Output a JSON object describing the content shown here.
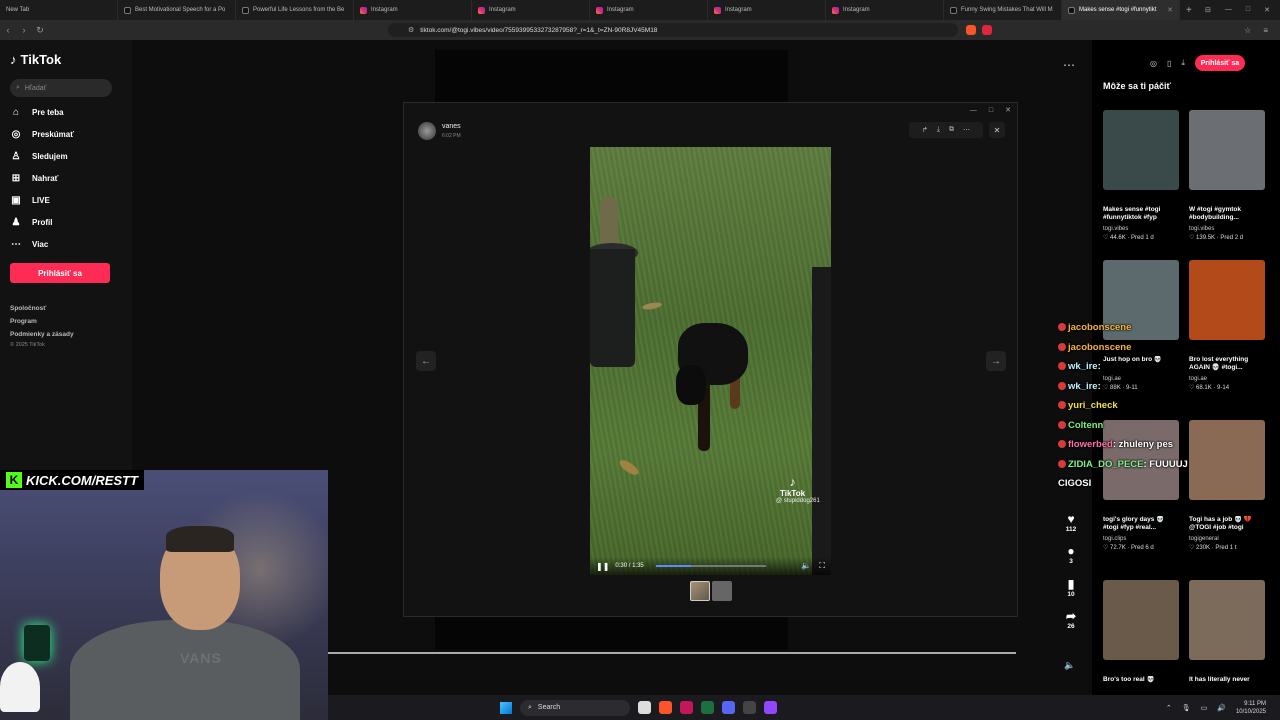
{
  "browser": {
    "tabs": [
      {
        "title": "New Tab",
        "icon": "none"
      },
      {
        "title": "Best Motivational Speech for a Po",
        "icon": "tiktok"
      },
      {
        "title": "Powerful Life Lessons from the Be",
        "icon": "tiktok"
      },
      {
        "title": "Instagram",
        "icon": "instagram"
      },
      {
        "title": "Instagram",
        "icon": "instagram"
      },
      {
        "title": "Instagram",
        "icon": "instagram"
      },
      {
        "title": "Instagram",
        "icon": "instagram"
      },
      {
        "title": "Instagram",
        "icon": "instagram"
      },
      {
        "title": "Funny Swing Mistakes That Will M",
        "icon": "tiktok"
      },
      {
        "title": "Makes sense #togi #funnytikt",
        "icon": "tiktok",
        "active": true
      }
    ],
    "url": "tiktok.com/@togi.vibes/video/7559399533273287958?_r=1&_t=ZN-90R8JV45M18"
  },
  "tiktok": {
    "logo": "TikTok",
    "search_placeholder": "Hľadať",
    "nav": [
      {
        "label": "Pre teba",
        "icon": "home-icon",
        "glyph": "⌂"
      },
      {
        "label": "Preskúmať",
        "icon": "compass-icon",
        "glyph": "◎"
      },
      {
        "label": "Sledujem",
        "icon": "following-icon",
        "glyph": "♙"
      },
      {
        "label": "Nahrať",
        "icon": "upload-icon",
        "glyph": "⊞"
      },
      {
        "label": "LIVE",
        "icon": "live-icon",
        "glyph": "▣"
      },
      {
        "label": "Profil",
        "icon": "profile-icon",
        "glyph": "♟"
      },
      {
        "label": "Viac",
        "icon": "more-icon",
        "glyph": "⋯"
      }
    ],
    "login_label": "Prihlásiť sa",
    "footer": {
      "links": [
        "Spoločnosť",
        "Program",
        "Podmienky a zásady"
      ],
      "copyright": "© 2025 TikTok"
    }
  },
  "viewer": {
    "username": "vanes",
    "time": "6:02 PM",
    "video": {
      "watermark": "TikTok",
      "handle": "@ stupiddog261",
      "time_display": "0:30 / 1:35",
      "progress": 0.32
    }
  },
  "engagement": {
    "likes": "112",
    "comments": "3",
    "saves": "10",
    "shares": "26"
  },
  "recommendations": {
    "title": "Môže sa ti páčiť",
    "login_label": "Prihlásiť sa",
    "cards": [
      {
        "title": "Makes sense #togi #funnytiktok #fyp",
        "author": "togi.vibes",
        "meta": "♡ 44.6K · Pred 1 d",
        "color": "#3a4a4a"
      },
      {
        "title": "W #togi #gymtok #bodybuilding...",
        "author": "togi.vibes",
        "meta": "♡ 139.5K · Pred 2 d",
        "color": "#6b6f73"
      },
      {
        "title": "Just hop on bro 💀",
        "author": "togi.ae",
        "meta": "♡ 88K · 9-11",
        "color": "#5d6a6d"
      },
      {
        "title": "Bro lost everything AGAIN 💀 #togi...",
        "author": "togi.ae",
        "meta": "♡ 68.1K · 9-14",
        "color": "#b34a1a"
      },
      {
        "title": "togi's glory days 💀 #togi #fyp #real...",
        "author": "togi.clips",
        "meta": "♡ 72.7K · Pred 6 d",
        "color": "#7a6a6a"
      },
      {
        "title": "Togi has a job 💀 💔 @TOGI #job #togi",
        "author": "togigeneral",
        "meta": "♡ 230K · Pred 1 t",
        "color": "#8a6a55"
      },
      {
        "title": "Bro's too real 💀",
        "author": "",
        "meta": "",
        "color": "#6a5a4a"
      },
      {
        "title": "It has literally never",
        "author": "",
        "meta": "",
        "color": "#7c6b5a"
      }
    ]
  },
  "stream": {
    "banner": "KICK.COM/RESTT",
    "shirt_text": "VANS",
    "chat": [
      {
        "user": "jacobonscene",
        "text": "",
        "color": "#f5b53c"
      },
      {
        "user": "jacobonscene",
        "text": "",
        "color": "#f5b53c"
      },
      {
        "user": "wk_ire",
        "text": ":",
        "color": "#bff2ff"
      },
      {
        "user": "wk_ire",
        "text": ":",
        "color": "#bff2ff"
      },
      {
        "user": "yuri_check",
        "text": "",
        "color": "#f1e047"
      },
      {
        "user": "Coltenn",
        "text": "",
        "color": "#7af07a"
      },
      {
        "user": "flowerbed",
        "text": ": zhuleny pes",
        "color": "#ff6fa8"
      },
      {
        "user": "ZIDIA_DO_PECE",
        "text": ": FUUUUJ",
        "color": "#7ef28b"
      },
      {
        "user": "",
        "text": "CIGOSI",
        "color": "#ffffff"
      }
    ]
  },
  "taskbar": {
    "search_label": "Search",
    "time": "9:11 PM",
    "date": "10/10/2025"
  }
}
